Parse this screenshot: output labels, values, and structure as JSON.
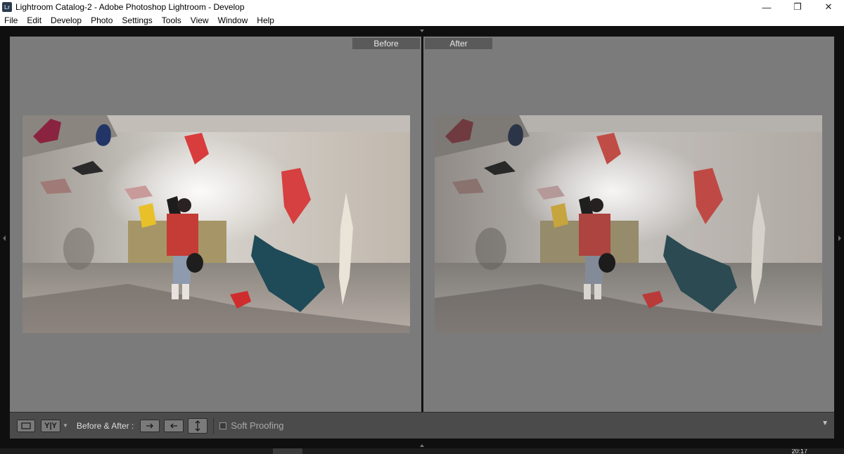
{
  "window": {
    "app_icon_text": "Lr",
    "title": "Lightroom Catalog-2 - Adobe Photoshop Lightroom - Develop",
    "controls": {
      "minimize": "—",
      "restore": "❐",
      "close": "✕"
    }
  },
  "menu": {
    "items": [
      "File",
      "Edit",
      "Develop",
      "Photo",
      "Settings",
      "Tools",
      "View",
      "Window",
      "Help"
    ]
  },
  "view": {
    "before_label": "Before",
    "after_label": "After"
  },
  "toolbar": {
    "loupe_icon": "loupe-view-icon",
    "yy_label": "Y|Y",
    "before_after_label": "Before & After :",
    "copy_before_to_after_icon": "arrow-right-icon",
    "copy_after_to_before_icon": "arrow-left-icon",
    "swap_icon": "swap-vertical-icon",
    "soft_proofing_label": "Soft Proofing",
    "soft_proofing_checked": false
  },
  "taskbar": {
    "clock_partial": "20:17"
  },
  "colors": {
    "panel_bg": "#7b7b7b",
    "toolbar_bg": "#4b4b4b",
    "label_bg": "#5a5a5a",
    "frame_bg": "#0f0f0f"
  }
}
